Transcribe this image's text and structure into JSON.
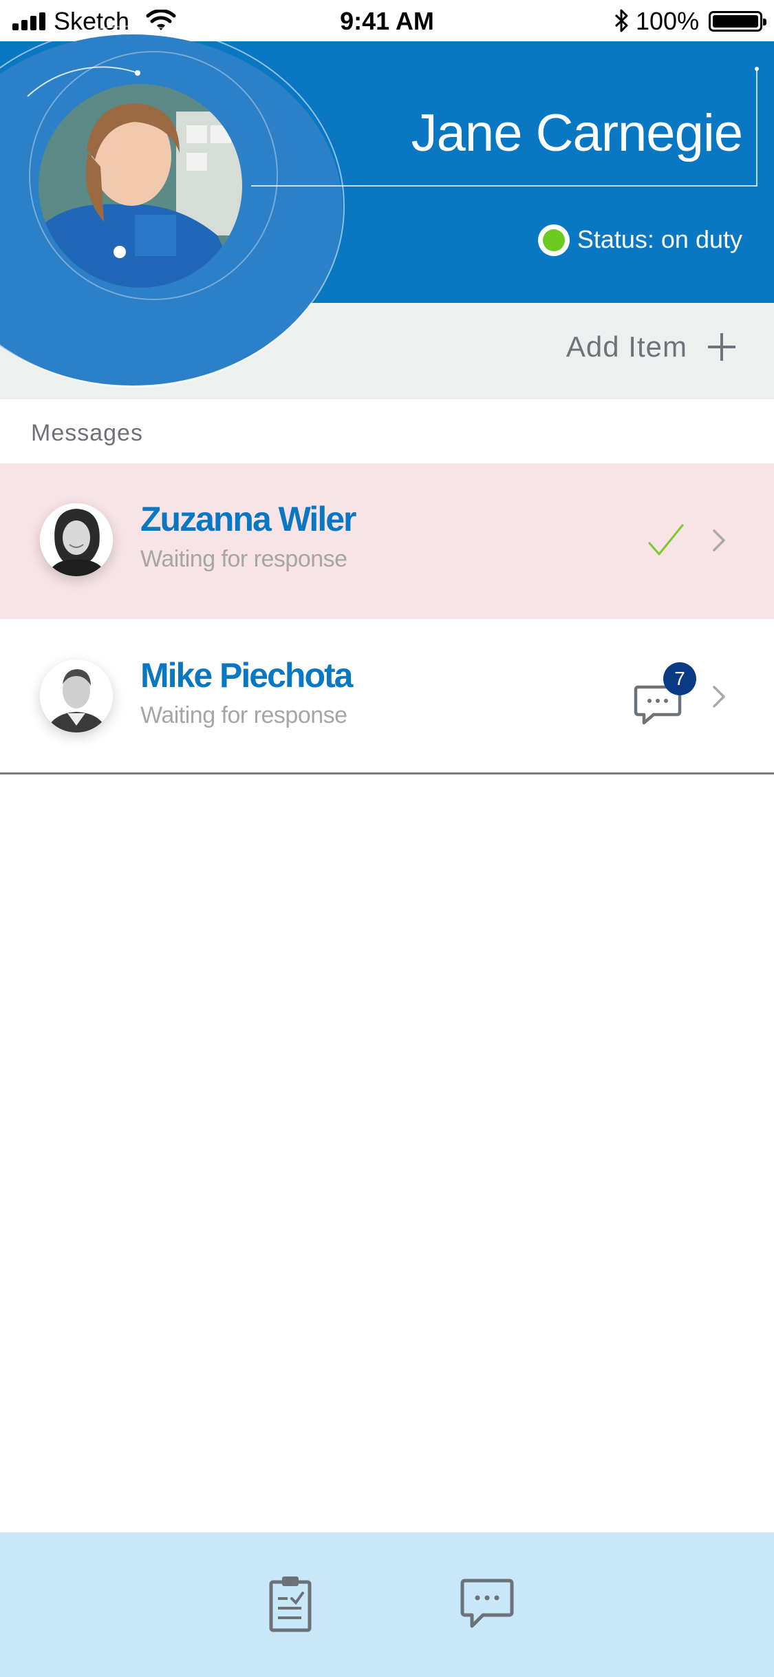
{
  "status_bar": {
    "carrier": "Sketch",
    "time": "9:41 AM",
    "battery": "100%"
  },
  "header": {
    "user_name": "Jane Carnegie",
    "status_text": "Status: on duty",
    "status_color": "#6ccb1f",
    "accent_color": "#0a77c2"
  },
  "actions": {
    "add_item_label": "Add Item",
    "add_icon": "plus-icon"
  },
  "messages": {
    "section_title": "Messages",
    "items": [
      {
        "name": "Zuzanna Wiler",
        "subtitle": "Waiting for response",
        "state": "answered",
        "icon": "checkmark-icon"
      },
      {
        "name": "Mike Piechota",
        "subtitle": "Waiting for response",
        "unread_count": "7",
        "icon": "chat-bubble-icon"
      }
    ]
  },
  "tab_bar": {
    "tabs": [
      {
        "icon": "clipboard-checklist-icon"
      },
      {
        "icon": "chat-bubble-icon"
      }
    ]
  }
}
